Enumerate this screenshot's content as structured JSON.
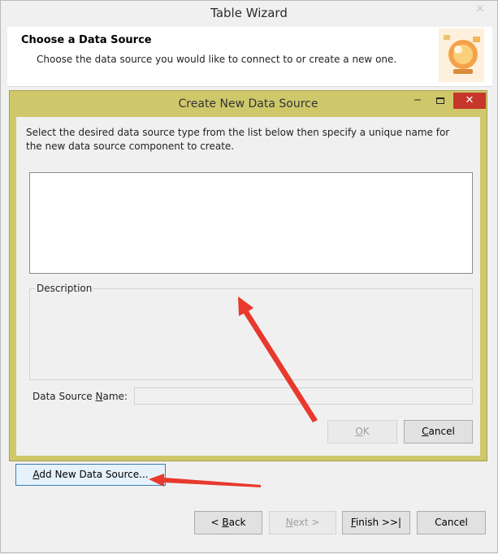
{
  "window": {
    "title": "Table Wizard",
    "close_glyph": "✕"
  },
  "header": {
    "title": "Choose a Data Source",
    "subtitle": "Choose the data source you would like to connect to or create a new one."
  },
  "dialog": {
    "title": "Create New Data Source",
    "minimize_glyph": "‒",
    "close_glyph": "✕",
    "intro": "Select the desired data source type from the list below then specify a unique name for the new data source component to create.",
    "description_label": "Description",
    "name_label_pre": "Data Source ",
    "name_label_mnemonic": "N",
    "name_label_post": "ame:",
    "name_value": "",
    "ok": {
      "mnemonic": "O",
      "rest": "K"
    },
    "cancel": {
      "mnemonic": "C",
      "rest": "ancel"
    }
  },
  "add_button": {
    "pre": "A",
    "rest": "dd New Data Source..."
  },
  "wizard_buttons": {
    "back": {
      "pre": "< ",
      "mnemonic": "B",
      "rest": "ack"
    },
    "next": {
      "mnemonic": "N",
      "rest": "ext >"
    },
    "finish": {
      "mnemonic": "F",
      "rest": "inish >>|"
    },
    "cancel": "Cancel"
  },
  "colors": {
    "dialog_frame": "#cfc86b",
    "close_red": "#c7362a",
    "arrow_red": "#e8392c"
  }
}
